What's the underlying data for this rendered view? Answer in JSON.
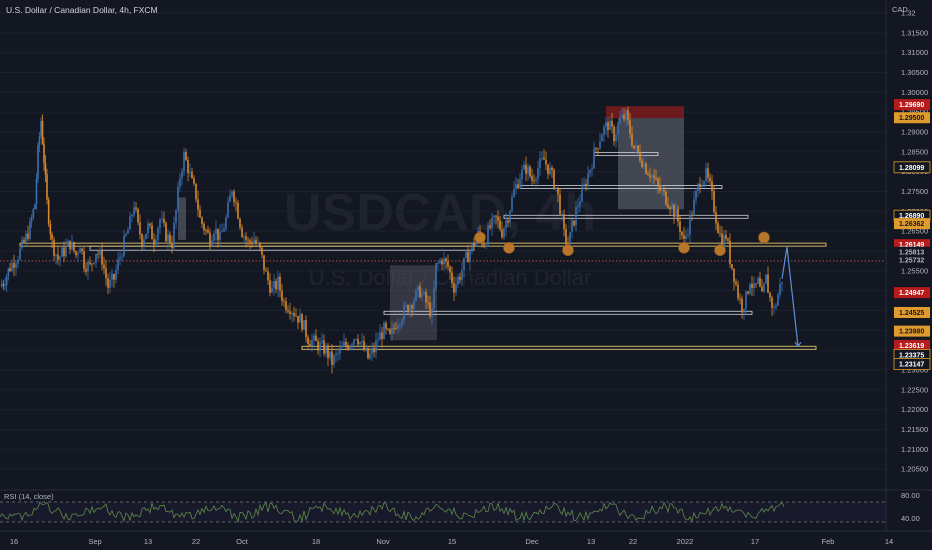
{
  "title": "U.S. Dollar / Canadian Dollar, 4h, FXCM",
  "watermark": {
    "symbol": "USDCAD, 4h",
    "name": "U.S. Dollar / Canadian Dollar"
  },
  "currency_label": "CAD",
  "rsi_label": "RSI (14, close)",
  "colors": {
    "background": "#131722",
    "candle_up": "#3a6fb0",
    "candle_down": "#d9892b",
    "level": "#e2c36b",
    "marker": "#b8762a",
    "red_tag": "#b71c1c",
    "orange_tag": "#e09b2e"
  },
  "chart_data": [
    {
      "type": "candlestick",
      "symbol": "USDCAD",
      "timeframe": "4h",
      "ylim": [
        1.2,
        1.32
      ],
      "y_ticks": [
        "1.20500",
        "1.21000",
        "1.21500",
        "1.22000",
        "1.22500",
        "1.23000",
        "1.23500",
        "1.24000",
        "1.24500",
        "1.25000",
        "1.25500",
        "1.26000",
        "1.26500",
        "1.27000",
        "1.27500",
        "1.28000",
        "1.28500",
        "1.29000",
        "1.29500",
        "1.30000",
        "1.30500",
        "1.31000",
        "1.31500",
        "1.32"
      ],
      "x_ticks": [
        "16",
        "Sep",
        "13",
        "22",
        "Oct",
        "18",
        "Nov",
        "15",
        "Dec",
        "13",
        "22",
        "2022",
        "17",
        "Feb",
        "14"
      ],
      "price_path": [
        [
          0,
          1.251
        ],
        [
          5,
          1.253
        ],
        [
          10,
          1.256
        ],
        [
          18,
          1.259
        ],
        [
          24,
          1.262
        ],
        [
          30,
          1.266
        ],
        [
          35,
          1.272
        ],
        [
          38,
          1.285
        ],
        [
          41,
          1.293
        ],
        [
          44,
          1.283
        ],
        [
          47,
          1.272
        ],
        [
          52,
          1.262
        ],
        [
          58,
          1.258
        ],
        [
          64,
          1.26
        ],
        [
          70,
          1.262
        ],
        [
          76,
          1.259
        ],
        [
          80,
          1.262
        ],
        [
          84,
          1.257
        ],
        [
          90,
          1.256
        ],
        [
          96,
          1.26
        ],
        [
          102,
          1.258
        ],
        [
          108,
          1.251
        ],
        [
          114,
          1.253
        ],
        [
          118,
          1.257
        ],
        [
          124,
          1.262
        ],
        [
          130,
          1.267
        ],
        [
          134,
          1.272
        ],
        [
          138,
          1.266
        ],
        [
          142,
          1.263
        ],
        [
          148,
          1.266
        ],
        [
          154,
          1.263
        ],
        [
          160,
          1.268
        ],
        [
          166,
          1.264
        ],
        [
          172,
          1.262
        ],
        [
          176,
          1.27
        ],
        [
          180,
          1.279
        ],
        [
          184,
          1.284
        ],
        [
          188,
          1.281
        ],
        [
          192,
          1.277
        ],
        [
          196,
          1.274
        ],
        [
          200,
          1.268
        ],
        [
          206,
          1.265
        ],
        [
          210,
          1.263
        ],
        [
          214,
          1.266
        ],
        [
          220,
          1.263
        ],
        [
          226,
          1.268
        ],
        [
          232,
          1.276
        ],
        [
          236,
          1.272
        ],
        [
          242,
          1.265
        ],
        [
          248,
          1.262
        ],
        [
          254,
          1.263
        ],
        [
          260,
          1.26
        ],
        [
          266,
          1.254
        ],
        [
          272,
          1.25
        ],
        [
          278,
          1.252
        ],
        [
          284,
          1.247
        ],
        [
          290,
          1.246
        ],
        [
          296,
          1.244
        ],
        [
          302,
          1.242
        ],
        [
          308,
          1.238
        ],
        [
          314,
          1.237
        ],
        [
          320,
          1.236
        ],
        [
          326,
          1.235
        ],
        [
          332,
          1.232
        ],
        [
          338,
          1.234
        ],
        [
          344,
          1.236
        ],
        [
          350,
          1.237
        ],
        [
          356,
          1.239
        ],
        [
          362,
          1.236
        ],
        [
          368,
          1.233
        ],
        [
          374,
          1.235
        ],
        [
          378,
          1.238
        ],
        [
          384,
          1.24
        ],
        [
          390,
          1.238
        ],
        [
          396,
          1.242
        ],
        [
          402,
          1.244
        ],
        [
          408,
          1.246
        ],
        [
          414,
          1.248
        ],
        [
          420,
          1.25
        ],
        [
          426,
          1.247
        ],
        [
          432,
          1.244
        ],
        [
          436,
          1.256
        ],
        [
          442,
          1.258
        ],
        [
          448,
          1.256
        ],
        [
          454,
          1.251
        ],
        [
          460,
          1.254
        ],
        [
          466,
          1.258
        ],
        [
          472,
          1.261
        ],
        [
          478,
          1.264
        ],
        [
          484,
          1.262
        ],
        [
          490,
          1.266
        ],
        [
          496,
          1.268
        ],
        [
          502,
          1.265
        ],
        [
          508,
          1.269
        ],
        [
          514,
          1.275
        ],
        [
          520,
          1.279
        ],
        [
          526,
          1.281
        ],
        [
          532,
          1.278
        ],
        [
          538,
          1.281
        ],
        [
          544,
          1.283
        ],
        [
          550,
          1.28
        ],
        [
          556,
          1.276
        ],
        [
          560,
          1.271
        ],
        [
          564,
          1.264
        ],
        [
          568,
          1.261
        ],
        [
          572,
          1.266
        ],
        [
          578,
          1.272
        ],
        [
          584,
          1.276
        ],
        [
          590,
          1.281
        ],
        [
          596,
          1.286
        ],
        [
          602,
          1.29
        ],
        [
          608,
          1.292
        ],
        [
          614,
          1.289
        ],
        [
          620,
          1.293
        ],
        [
          626,
          1.294
        ],
        [
          630,
          1.29
        ],
        [
          634,
          1.286
        ],
        [
          640,
          1.284
        ],
        [
          646,
          1.281
        ],
        [
          652,
          1.279
        ],
        [
          658,
          1.276
        ],
        [
          664,
          1.274
        ],
        [
          670,
          1.272
        ],
        [
          676,
          1.269
        ],
        [
          680,
          1.266
        ],
        [
          684,
          1.262
        ],
        [
          688,
          1.266
        ],
        [
          694,
          1.272
        ],
        [
          700,
          1.278
        ],
        [
          706,
          1.279
        ],
        [
          710,
          1.276
        ],
        [
          714,
          1.271
        ],
        [
          718,
          1.266
        ],
        [
          722,
          1.262
        ],
        [
          726,
          1.264
        ],
        [
          730,
          1.258
        ],
        [
          734,
          1.254
        ],
        [
          738,
          1.249
        ],
        [
          742,
          1.246
        ],
        [
          746,
          1.248
        ],
        [
          750,
          1.253
        ],
        [
          754,
          1.25
        ],
        [
          758,
          1.252
        ],
        [
          762,
          1.248
        ],
        [
          766,
          1.253
        ],
        [
          770,
          1.248
        ],
        [
          774,
          1.245
        ],
        [
          778,
          1.249
        ],
        [
          782,
          1.253
        ]
      ],
      "projection": [
        [
          782,
          1.253
        ],
        [
          787,
          1.261
        ],
        [
          798,
          1.236
        ]
      ],
      "levels": [
        {
          "price": 1.2616,
          "x0": 20,
          "x1": 826
        },
        {
          "price": 1.2356,
          "x0": 302,
          "x1": 816
        },
        {
          "price": 1.2575,
          "x0": 0,
          "x1": 886,
          "dotted": true
        }
      ],
      "zones": [
        {
          "x0": 90,
          "x1": 474,
          "y0": 1.2612,
          "y1": 1.2602
        },
        {
          "x0": 520,
          "x1": 722,
          "y0": 1.2765,
          "y1": 1.2758
        },
        {
          "x0": 504,
          "x1": 748,
          "y0": 1.269,
          "y1": 1.2683
        },
        {
          "x0": 594,
          "x1": 658,
          "y0": 1.2848,
          "y1": 1.2841
        },
        {
          "x0": 384,
          "x1": 752,
          "y0": 1.2448,
          "y1": 1.2441
        }
      ],
      "boxes": [
        {
          "x0": 390,
          "x1": 437,
          "y0": 1.2564,
          "y1": 1.2375,
          "fill": "#5d606b",
          "opacity": 0.45
        },
        {
          "x0": 606,
          "x1": 684,
          "y0": 1.2965,
          "y1": 1.2935,
          "fill": "#9b1c1c",
          "opacity": 0.65
        },
        {
          "x0": 618,
          "x1": 684,
          "y0": 1.2935,
          "y1": 1.2705,
          "fill": "#7d808b",
          "opacity": 0.45
        },
        {
          "x0": 178,
          "x1": 186,
          "y0": 1.2735,
          "y1": 1.2628,
          "fill": "#7d808b",
          "opacity": 0.45
        }
      ],
      "markers": [
        {
          "x": 480,
          "price": 1.2634
        },
        {
          "x": 509,
          "price": 1.2608
        },
        {
          "x": 568,
          "price": 1.2602
        },
        {
          "x": 684,
          "price": 1.2608
        },
        {
          "x": 720,
          "price": 1.2602
        },
        {
          "x": 764,
          "price": 1.2634
        }
      ],
      "price_tags": [
        {
          "price": 1.2969,
          "text": "1.29690",
          "style": "red"
        },
        {
          "price": 1.2936,
          "text": "1.29500",
          "style": "orange"
        },
        {
          "price": 1.2811,
          "text": "1.28099",
          "style": "outline"
        },
        {
          "price": 1.2689,
          "text": "1.26890",
          "style": "outline"
        },
        {
          "price": 1.2669,
          "text": "1.26362",
          "style": "orange"
        },
        {
          "price": 1.2616,
          "text": "1.26149",
          "style": "red"
        },
        {
          "price": 1.2597,
          "text": "1.25813",
          "style": "plain"
        },
        {
          "price": 1.2577,
          "text": "1.25732",
          "style": "plain"
        },
        {
          "price": 1.2495,
          "text": "1.24947",
          "style": "red"
        },
        {
          "price": 1.2445,
          "text": "1.24525",
          "style": "orange"
        },
        {
          "price": 1.2398,
          "text": "1.23980",
          "style": "orange"
        },
        {
          "price": 1.2362,
          "text": "1.23619",
          "style": "red"
        },
        {
          "price": 1.2338,
          "text": "1.23375",
          "style": "outline"
        },
        {
          "price": 1.2315,
          "text": "1.23147",
          "style": "outline"
        }
      ],
      "rsi": {
        "upper": "80.00",
        "lower": "40.00",
        "length": 14
      }
    }
  ]
}
